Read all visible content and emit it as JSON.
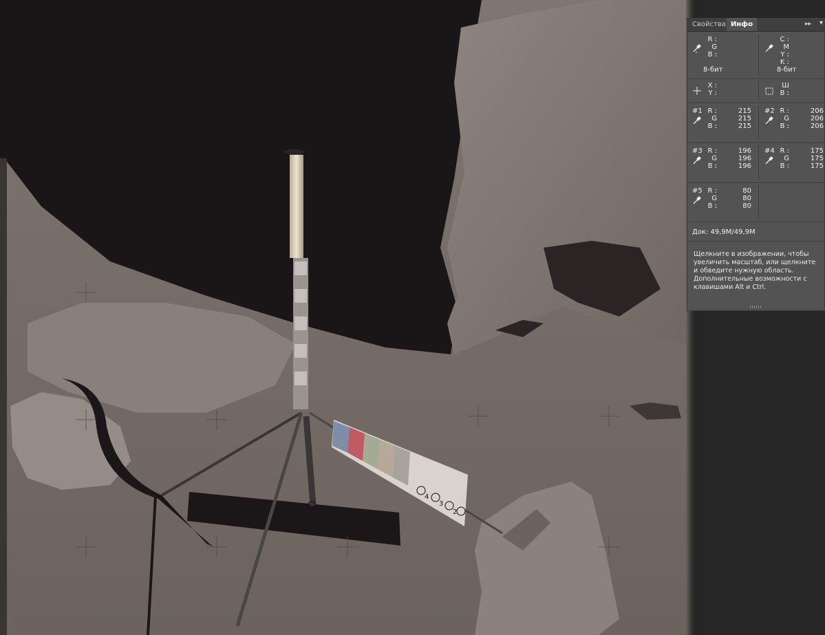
{
  "panel": {
    "tabs": [
      {
        "label": "Свойства",
        "active": false
      },
      {
        "label": "Инфо",
        "active": true
      }
    ],
    "collapse_icon": "double-chevron-right-icon",
    "menu_icon": "panel-menu-icon",
    "rgb_readout": {
      "labels": [
        "R :",
        "G :",
        "B :"
      ],
      "bit_depth": "8-бит"
    },
    "cmyk_readout": {
      "labels": [
        "C :",
        "M :",
        "Y :",
        "K :"
      ],
      "bit_depth": "8-бит"
    },
    "position": {
      "labels": [
        "X :",
        "Y :"
      ]
    },
    "size": {
      "labels": [
        "Ш :",
        "В :"
      ]
    },
    "samplers": [
      {
        "id": "#1",
        "R": "215",
        "G": "215",
        "B": "215"
      },
      {
        "id": "#2",
        "R": "206",
        "G": "206",
        "B": "206"
      },
      {
        "id": "#3",
        "R": "196",
        "G": "196",
        "B": "196"
      },
      {
        "id": "#4",
        "R": "175",
        "G": "175",
        "B": "175"
      },
      {
        "id": "#5",
        "R": "80",
        "G": "80",
        "B": "80"
      }
    ],
    "channel_labels": [
      "R :",
      "G :",
      "B :"
    ],
    "doc_size": "Док: 49,9M/49,9M",
    "hint": "Щелкните в изображении, чтобы увеличить масштаб, или щелкните и обведите нужную область. Дополнительные возможности с клавишами Alt и Ctrl."
  },
  "canvas": {
    "sampler_markers": [
      "4",
      "3",
      "2",
      "1"
    ]
  },
  "colors": {
    "panel_bg": "#535353",
    "tab_bar_bg": "#3f3f3f",
    "workspace_bg": "#262626"
  }
}
